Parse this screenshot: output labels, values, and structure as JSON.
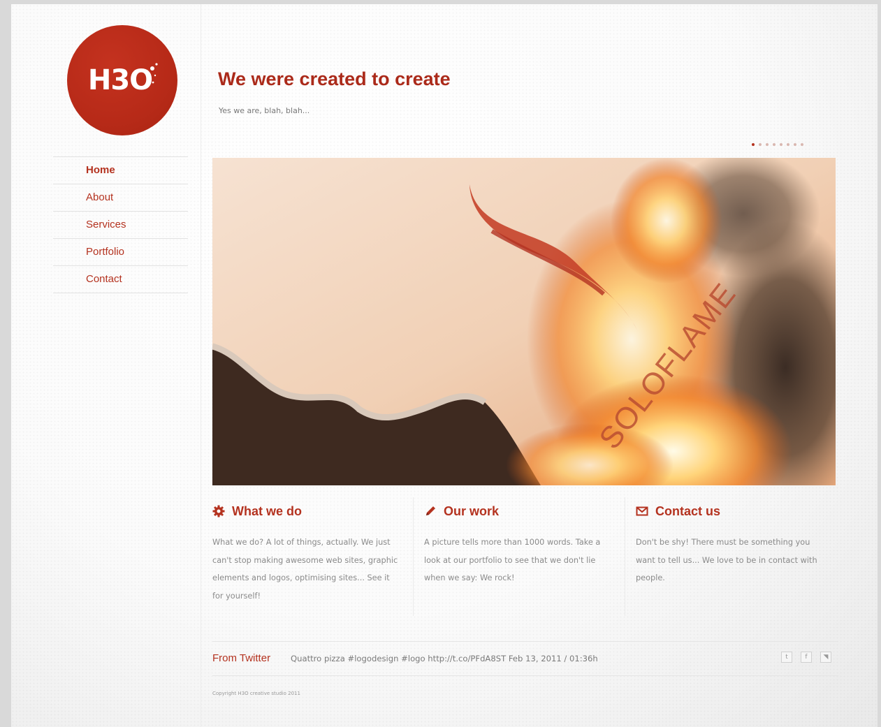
{
  "brand": {
    "logo_text": "H3O",
    "accent": "#b4321f"
  },
  "nav": {
    "items": [
      {
        "label": "Home",
        "active": true
      },
      {
        "label": "About"
      },
      {
        "label": "Services"
      },
      {
        "label": "Portfolio"
      },
      {
        "label": "Contact"
      }
    ]
  },
  "header": {
    "title": "We were created to create",
    "subtitle": "Yes we are, blah, blah..."
  },
  "slider": {
    "slide_count": 8,
    "active_index": 0,
    "image_text": "SOLOFLAME"
  },
  "columns": [
    {
      "icon": "gear-icon",
      "title": "What we do",
      "text": "What we do? A lot of things, actually. We just can't stop making awesome web sites, graphic elements and logos, optimising sites... See it for yourself!"
    },
    {
      "icon": "pencil-icon",
      "title": "Our work",
      "text": "A picture tells more than 1000 words. Take a look at our portfolio to see that we don't lie when we say: We rock!"
    },
    {
      "icon": "envelope-icon",
      "title": "Contact us",
      "text": "Don't be shy! There must be something you want to tell us... We love to be in contact with people."
    }
  ],
  "twitter": {
    "label": "From Twitter",
    "tweet": "Quattro pizza #logodesign #logo http://t.co/PFdA8ST Feb 13, 2011 / 01:36h"
  },
  "social": [
    {
      "icon": "twitter-icon",
      "glyph": "t"
    },
    {
      "icon": "facebook-icon",
      "glyph": "f"
    },
    {
      "icon": "rss-icon",
      "glyph": "◥"
    }
  ],
  "footer": {
    "copyright": "Copyright H3O creative studio 2011"
  }
}
